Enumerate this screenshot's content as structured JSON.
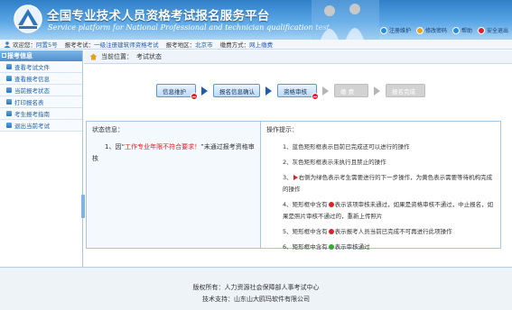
{
  "header": {
    "title_cn": "全国专业技术人员资格考试报名服务平台",
    "title_en": "Service platform for National Professional and technician qualification test",
    "links": [
      {
        "label": "注册维护",
        "icon": "user-maintain-icon",
        "color": "#2a8ad6"
      },
      {
        "label": "修改密码",
        "icon": "key-icon",
        "color": "#e6a21b"
      },
      {
        "label": "帮助",
        "icon": "help-icon",
        "color": "#2a8ad6"
      },
      {
        "label": "安全退出",
        "icon": "logout-icon",
        "color": "#d8232a"
      }
    ]
  },
  "infobar": {
    "welcome_label": "欢迎您：",
    "welcome_value": "阿置5号",
    "exam_label": "报考考试：",
    "exam_value": "一级注册建筑师资格考试",
    "region_label": "报考地区：",
    "region_value": "北京市",
    "pay_label": "缴费方式：",
    "pay_value": "网上缴费"
  },
  "sidebar": {
    "title": "报考信息",
    "items": [
      {
        "label": "查看考试文件"
      },
      {
        "label": "查看报考信息"
      },
      {
        "label": "当前报考状态"
      },
      {
        "label": "打印报名表"
      },
      {
        "label": "考生报考指南"
      },
      {
        "label": "退出当前考试"
      }
    ]
  },
  "location": {
    "label": "当前位置：",
    "value": "考试状态"
  },
  "steps": [
    {
      "label": "信息维护",
      "state": "done",
      "error": true
    },
    {
      "label": "报名信息确认",
      "state": "done",
      "error": false
    },
    {
      "label": "资格审核",
      "state": "done",
      "error": true
    },
    {
      "label": "缴 费",
      "state": "inactive",
      "error": false
    },
    {
      "label": "报名完成",
      "state": "inactive",
      "error": false
    }
  ],
  "status": {
    "title": "状态信息：",
    "prefix": "1、因“",
    "highlight": "工作专业年限不符合要求！",
    "suffix": "”未通过报考资格审核"
  },
  "tips": {
    "title": "操作提示：",
    "rules": [
      {
        "num": "1、",
        "text": "蓝色矩形框表示目前已完成还可以进行的操作"
      },
      {
        "num": "2、",
        "text": "灰色矩形框表示未执行且禁止的操作"
      },
      {
        "num": "3、",
        "text": "右侧为绿色表示考生需要进行的下一步操作，为黄色表示需要等待机构完成的操作"
      },
      {
        "num": "4、",
        "text_before": "矩形框中含有",
        "text_after": "表示该项审核未通过，如果是资格审核不通过，中止报名，如果是照片审核不通过的，重新上传照片"
      },
      {
        "num": "5、",
        "text_before": "矩形框中含有",
        "text_after": "表示报考人员当前已完成不可再进行此项操作"
      },
      {
        "num": "6、",
        "text_before": "矩形框中含有",
        "text_after": "表示审核通过"
      }
    ]
  },
  "footer": {
    "line1": "版权所有：人力资源社会保障部人事考试中心",
    "line2": "技术支持：山东山大鸥玛软件有限公司"
  }
}
